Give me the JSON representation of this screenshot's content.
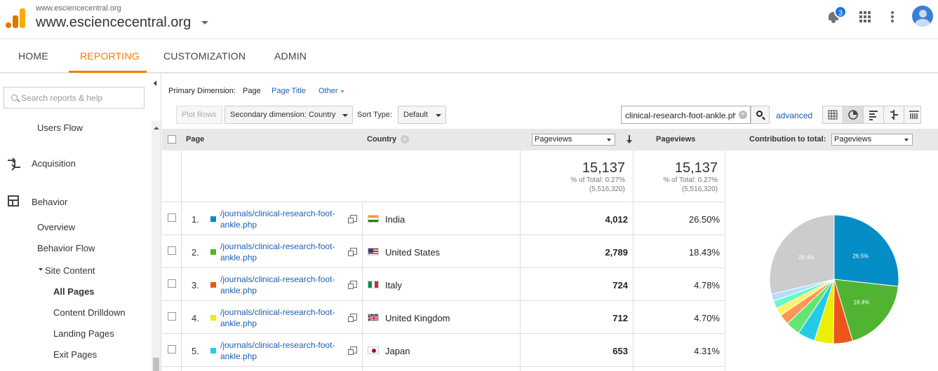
{
  "header": {
    "site_small": "www.esciencecentral.org",
    "site_big": "www.esciencecentral.org",
    "notification_count": "3"
  },
  "nav": {
    "home": "HOME",
    "reporting": "REPORTING",
    "customization": "CUSTOMIZATION",
    "admin": "ADMIN"
  },
  "sidebar": {
    "search_placeholder": "Search reports & help",
    "users_flow": "Users Flow",
    "acquisition": "Acquisition",
    "behavior": "Behavior",
    "overview": "Overview",
    "behavior_flow": "Behavior Flow",
    "site_content": "Site Content",
    "all_pages": "All Pages",
    "content_drilldown": "Content Drilldown",
    "landing_pages": "Landing Pages",
    "exit_pages": "Exit Pages"
  },
  "controls": {
    "primary_dimension_label": "Primary Dimension:",
    "page": "Page",
    "page_title": "Page Title",
    "other": "Other",
    "plot_rows": "Plot Rows",
    "secondary_dimension": "Secondary dimension: Country",
    "sort_type_label": "Sort Type:",
    "sort_type_value": "Default",
    "filter_value": "clinical-research-foot-ankle.ph",
    "advanced": "advanced"
  },
  "table": {
    "col_page": "Page",
    "col_country": "Country",
    "metric_select": "Pageviews",
    "col_pageviews": "Pageviews",
    "contribution_label": "Contribution to total:",
    "contribution_select": "Pageviews",
    "totals": {
      "value": "15,137",
      "pct_of_total": "% of Total: 0.27%",
      "grand_total": "(5,516,320)"
    },
    "rows": [
      {
        "idx": "1.",
        "page": "/journals/clinical-research-foot-ankle.php",
        "country": "India",
        "pageviews": "4,012",
        "pct": "26.50%",
        "color": "#058dc7",
        "flag": "india"
      },
      {
        "idx": "2.",
        "page": "/journals/clinical-research-foot-ankle.php",
        "country": "United States",
        "pageviews": "2,789",
        "pct": "18.43%",
        "color": "#50b432",
        "flag": "us"
      },
      {
        "idx": "3.",
        "page": "/journals/clinical-research-foot-ankle.php",
        "country": "Italy",
        "pageviews": "724",
        "pct": "4.78%",
        "color": "#ed561b",
        "flag": "italy"
      },
      {
        "idx": "4.",
        "page": "/journals/clinical-research-foot-ankle.php",
        "country": "United Kingdom",
        "pageviews": "712",
        "pct": "4.70%",
        "color": "#edef00",
        "flag": "uk"
      },
      {
        "idx": "5.",
        "page": "/journals/clinical-research-foot-ankle.php",
        "country": "Japan",
        "pageviews": "653",
        "pct": "4.31%",
        "color": "#24cbe5",
        "flag": "japan"
      }
    ]
  },
  "chart_data": {
    "type": "pie",
    "title": "",
    "slices": [
      {
        "label": "India",
        "value": 26.5,
        "color": "#058dc7",
        "shown_label": "26.5%"
      },
      {
        "label": "United States",
        "value": 18.43,
        "color": "#50b432",
        "shown_label": "18.4%"
      },
      {
        "label": "Italy",
        "value": 4.78,
        "color": "#ed561b",
        "shown_label": ""
      },
      {
        "label": "United Kingdom",
        "value": 4.7,
        "color": "#edef00",
        "shown_label": ""
      },
      {
        "label": "Japan",
        "value": 4.31,
        "color": "#24cbe5",
        "shown_label": ""
      },
      {
        "label": "",
        "value": 3.6,
        "color": "#64e572",
        "shown_label": ""
      },
      {
        "label": "",
        "value": 2.6,
        "color": "#ff9655",
        "shown_label": ""
      },
      {
        "label": "",
        "value": 2.0,
        "color": "#fff263",
        "shown_label": ""
      },
      {
        "label": "",
        "value": 1.9,
        "color": "#6af9c4",
        "shown_label": ""
      },
      {
        "label": "",
        "value": 1.8,
        "color": "#b2deff",
        "shown_label": ""
      },
      {
        "label": "",
        "value": 28.4,
        "color": "#cccccc",
        "shown_label": "28.4%"
      }
    ]
  }
}
